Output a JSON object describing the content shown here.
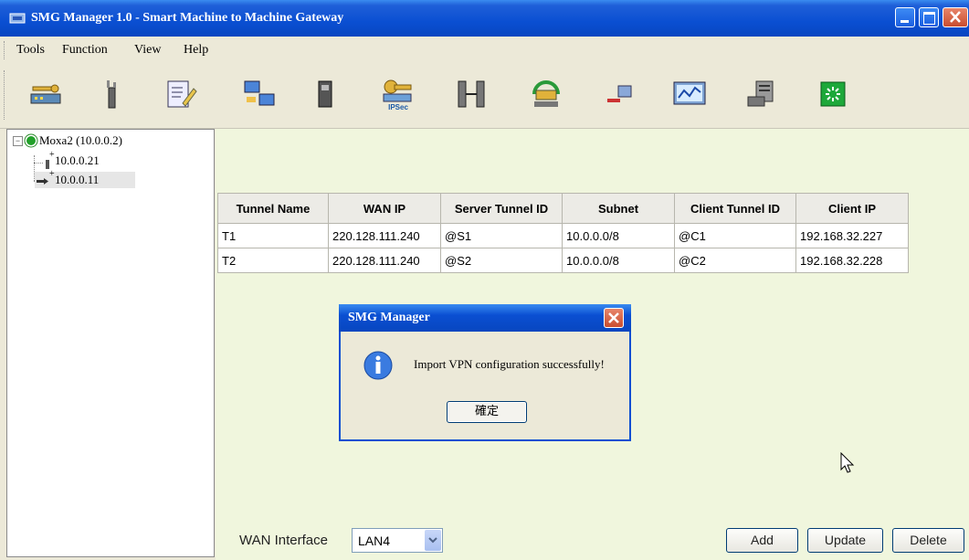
{
  "window": {
    "title": "SMG Manager 1.0 - Smart Machine to Machine Gateway"
  },
  "menu": [
    "Tools",
    "Function",
    "View",
    "Help"
  ],
  "toolbar": [
    "gateway-key-icon",
    "tower-icon",
    "edit-icon",
    "network-transfer-icon",
    "device-icon",
    "ipsec-key-icon",
    "switch-icon",
    "router-refresh-icon",
    "connect-icon",
    "monitor-icon",
    "server-icon",
    "status-icon"
  ],
  "toolbar_ipsec_label": "IPSec",
  "tree": {
    "root": "Moxa2 (10.0.0.2)",
    "children": [
      "10.0.0.21",
      "10.0.0.11"
    ],
    "plus": "+"
  },
  "table": {
    "headers": [
      "Tunnel Name",
      "WAN IP",
      "Server Tunnel ID",
      "Subnet",
      "Client Tunnel ID",
      "Client IP"
    ],
    "rows": [
      [
        "T1",
        "220.128.111.240",
        "@S1",
        "10.0.0.0/8",
        "@C1",
        "192.168.32.227"
      ],
      [
        "T2",
        "220.128.111.240",
        "@S2",
        "10.0.0.0/8",
        "@C2",
        "192.168.32.228"
      ]
    ]
  },
  "dialog": {
    "title": "SMG Manager",
    "message": "Import VPN configuration successfully!",
    "ok": "確定"
  },
  "wan": {
    "label": "WAN Interface",
    "value": "LAN4"
  },
  "buttons": {
    "add": "Add",
    "update": "Update",
    "delete": "Delete"
  }
}
